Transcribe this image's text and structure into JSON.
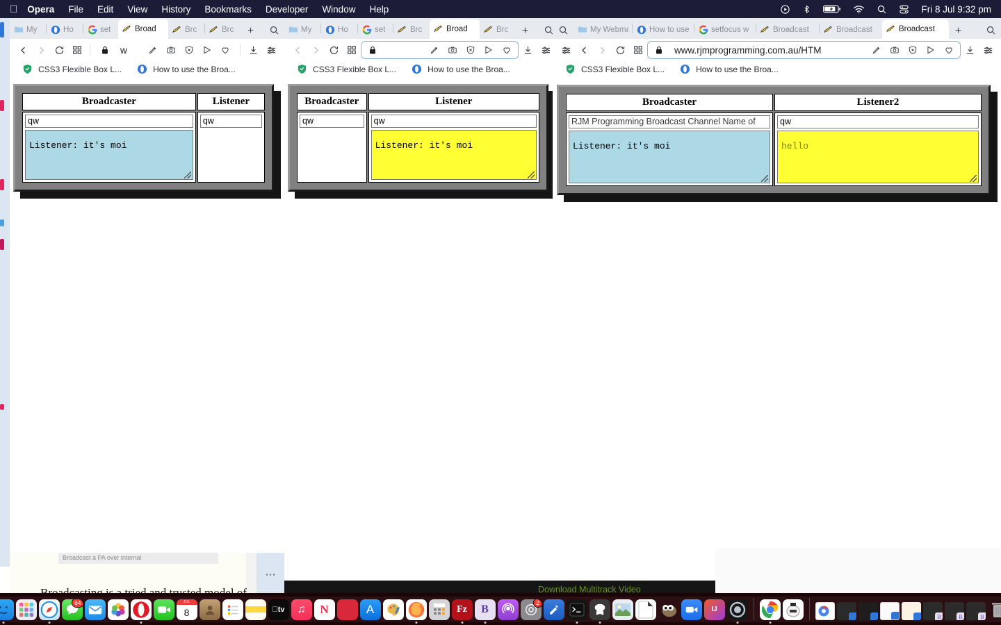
{
  "menubar": {
    "apple_icon": "apple-logo-icon",
    "items": [
      {
        "label": "Opera",
        "bold": true
      },
      {
        "label": "File",
        "bold": false
      },
      {
        "label": "Edit",
        "bold": false
      },
      {
        "label": "View",
        "bold": false
      },
      {
        "label": "History",
        "bold": false
      },
      {
        "label": "Bookmarks",
        "bold": false
      },
      {
        "label": "Developer",
        "bold": false
      },
      {
        "label": "Window",
        "bold": false
      },
      {
        "label": "Help",
        "bold": false
      }
    ],
    "status_icons": [
      "play-circle-icon",
      "bluetooth-icon",
      "battery-charging-icon",
      "wifi-icon",
      "search-icon",
      "control-center-icon"
    ],
    "clock": "Fri 8 Jul  9:32 pm"
  },
  "windows": [
    {
      "tabs": [
        {
          "label": "My",
          "favicon": "folder-icon",
          "active": false
        },
        {
          "label": "Ho",
          "favicon": "opera-blue-icon",
          "active": false
        },
        {
          "label": "set",
          "favicon": "google-icon",
          "active": false
        },
        {
          "label": "Broad",
          "favicon": "broadcast-icon",
          "active": true
        },
        {
          "label": "Brc",
          "favicon": "broadcast-icon",
          "active": false
        },
        {
          "label": "Brc",
          "favicon": "broadcast-icon",
          "active": false
        }
      ],
      "address": {
        "url": "w",
        "focused": false,
        "lock_icon": "padlock-icon"
      },
      "bookmarks": [
        {
          "label": "CSS3 Flexible Box L...",
          "favicon": "shield-green-icon"
        },
        {
          "label": "How to use the Broa...",
          "favicon": "opera-blue-icon"
        }
      ],
      "panel": {
        "columns": [
          "Broadcaster",
          "Listener"
        ],
        "broadcaster": {
          "input_value": "qw",
          "textarea_value": "Listener: it's moi",
          "textarea_color": "blue",
          "has_textarea": true
        },
        "listener": {
          "input_value": "qw",
          "textarea_value": "",
          "textarea_color": "none",
          "has_textarea": false
        }
      }
    },
    {
      "tabs": [
        {
          "label": "My",
          "favicon": "folder-icon",
          "active": false
        },
        {
          "label": "Ho",
          "favicon": "opera-blue-icon",
          "active": false
        },
        {
          "label": "set",
          "favicon": "google-icon",
          "active": false
        },
        {
          "label": "Brc",
          "favicon": "broadcast-icon",
          "active": false
        },
        {
          "label": "Broad",
          "favicon": "broadcast-icon",
          "active": true
        },
        {
          "label": "Brc",
          "favicon": "broadcast-icon",
          "active": false
        }
      ],
      "address": {
        "url": "",
        "focused": true,
        "lock_icon": "padlock-icon"
      },
      "bookmarks": [
        {
          "label": "CSS3 Flexible Box L...",
          "favicon": "shield-green-icon"
        },
        {
          "label": "How to use the Broa...",
          "favicon": "opera-blue-icon"
        }
      ],
      "panel": {
        "columns": [
          "Broadcaster",
          "Listener"
        ],
        "broadcaster": {
          "input_value": "qw",
          "textarea_value": "",
          "textarea_color": "none",
          "has_textarea": false
        },
        "listener": {
          "input_value": "qw",
          "textarea_value": "Listener: it's moi",
          "textarea_color": "yellow",
          "has_textarea": true
        }
      }
    },
    {
      "tabs": [
        {
          "label": "My Webma",
          "favicon": "folder-icon",
          "active": false
        },
        {
          "label": "How to use",
          "favicon": "opera-blue-icon",
          "active": false
        },
        {
          "label": "setfocus w",
          "favicon": "google-icon",
          "active": false
        },
        {
          "label": "Broadcast",
          "favicon": "broadcast-icon",
          "active": false
        },
        {
          "label": "Broadcast",
          "favicon": "broadcast-icon",
          "active": false
        },
        {
          "label": "Broadcast",
          "favicon": "broadcast-icon",
          "active": true
        }
      ],
      "address": {
        "url": "www.rjmprogramming.com.au/HTM",
        "focused": true,
        "lock_icon": "padlock-icon"
      },
      "bookmarks": [
        {
          "label": "CSS3 Flexible Box L...",
          "favicon": "shield-green-icon"
        },
        {
          "label": "How to use the Broa...",
          "favicon": "opera-blue-icon"
        }
      ],
      "panel": {
        "columns": [
          "Broadcaster",
          "Listener2"
        ],
        "broadcaster": {
          "input_value": "RJM Programming Broadcast Channel Name of",
          "input_is_placeholder": true,
          "textarea_value": "Listener: it's moi",
          "textarea_color": "blue",
          "has_textarea": true
        },
        "listener": {
          "input_value": "qw",
          "textarea_value": "hello",
          "textarea_is_placeholder": true,
          "textarea_color": "yellow",
          "has_textarea": true
        }
      }
    }
  ],
  "toolbar_icons": {
    "back": "chevron-left-icon",
    "forward": "chevron-right-icon",
    "reload": "reload-icon",
    "tiles": "grid-tiles-icon",
    "download": "download-icon",
    "settings": "sliders-icon",
    "pin": "pin-edit-icon",
    "snapshot": "camera-icon",
    "adblock": "shield-x-icon",
    "share": "send-triangle-icon",
    "favorite": "heart-icon",
    "search": "search-icon",
    "plus": "plus-icon"
  },
  "background_windows": {
    "left_text": "Broadcasting is a tried and trusted model of",
    "left_caption": "Broadcast a PA over internal",
    "more_icon": "ellipsis-icon",
    "right_text": "Download Multitrack Video",
    "right_text_color": "#6a8f2a"
  },
  "dock": {
    "items": [
      {
        "name": "finder",
        "glyph": "",
        "bg": "linear-gradient(180deg,#2ba8f5,#1c7fe0)",
        "running": true
      },
      {
        "name": "launchpad",
        "glyph": "",
        "bg": "#e9e9ee",
        "running": false
      },
      {
        "name": "safari",
        "glyph": "",
        "bg": "linear-gradient(180deg,#f2f7fb,#cfe3f3)",
        "running": true
      },
      {
        "name": "messages",
        "glyph": "",
        "bg": "linear-gradient(180deg,#6ee86c,#23c11f)",
        "badge": "64",
        "running": false
      },
      {
        "name": "mail",
        "glyph": "",
        "bg": "linear-gradient(180deg,#4ab8f7,#1d8ce8)",
        "running": false
      },
      {
        "name": "photos",
        "glyph": "",
        "bg": "#ffffff",
        "running": false
      },
      {
        "name": "opera",
        "glyph": "",
        "bg": "#ffffff",
        "running": true
      },
      {
        "name": "facetime",
        "glyph": "",
        "bg": "linear-gradient(180deg,#5ce45a,#22c21f)",
        "running": false
      },
      {
        "name": "calendar",
        "glyph": "8",
        "bg": "#ffffff",
        "running": false
      },
      {
        "name": "contacts",
        "glyph": "",
        "bg": "linear-gradient(180deg,#c09a6b,#8a6b44)",
        "running": false
      },
      {
        "name": "reminders",
        "glyph": "",
        "bg": "#ffffff",
        "running": false
      },
      {
        "name": "notes",
        "glyph": "",
        "bg": "linear-gradient(180deg,#ffd83d,#fff8e0)",
        "running": false
      },
      {
        "name": "apple-tv",
        "glyph": "tv",
        "bg": "#0b0b0b",
        "running": false
      },
      {
        "name": "music",
        "glyph": "",
        "bg": "linear-gradient(180deg,#fb4c6a,#f5305a)",
        "running": false
      },
      {
        "name": "news",
        "glyph": "N",
        "bg": "#ffffff",
        "running": false
      },
      {
        "name": "keynote-red",
        "glyph": "",
        "bg": "#d8283a",
        "running": false
      },
      {
        "name": "app-store",
        "glyph": "A",
        "bg": "linear-gradient(180deg,#2c9df7,#0b6fdc)",
        "running": false
      },
      {
        "name": "paint-palette",
        "glyph": "",
        "bg": "#ffffff",
        "running": false
      },
      {
        "name": "firefox",
        "glyph": "",
        "bg": "#ffffff",
        "running": true
      },
      {
        "name": "calculator",
        "glyph": "",
        "bg": "#d5d5d8",
        "running": false
      },
      {
        "name": "filezilla",
        "glyph": "Fz",
        "bg": "#b4121b",
        "running": true
      },
      {
        "name": "bootstrap",
        "glyph": "B",
        "bg": "#e6e0f2",
        "running": true
      },
      {
        "name": "podcasts",
        "glyph": "",
        "bg": "linear-gradient(180deg,#bf5af2,#8e3fd4)",
        "running": false
      },
      {
        "name": "system-settings",
        "glyph": "",
        "bg": "#8a8a8f",
        "badge": "2",
        "running": false
      },
      {
        "name": "xcode",
        "glyph": "",
        "bg": "linear-gradient(180deg,#3a7ddd,#1b5bbf)",
        "running": false
      },
      {
        "name": "terminal",
        "glyph": "",
        "bg": "#1a1a1a",
        "running": true
      },
      {
        "name": "mamp",
        "glyph": "",
        "bg": "#3a3a3a",
        "running": true
      },
      {
        "name": "preview",
        "glyph": "",
        "bg": "#e8eef4",
        "running": false
      },
      {
        "name": "textedit",
        "glyph": "",
        "bg": "#ffffff",
        "running": false
      },
      {
        "name": "gimp",
        "glyph": "",
        "bg": "transparent",
        "running": false
      },
      {
        "name": "zoom",
        "glyph": "",
        "bg": "linear-gradient(180deg,#3d8bfd,#1a6fe8)",
        "running": false
      },
      {
        "name": "intellij",
        "glyph": "IJ",
        "bg": "linear-gradient(135deg,#f05a28,#9b3bd9)",
        "running": false
      },
      {
        "name": "quicktime",
        "glyph": "",
        "bg": "#1a1a1a",
        "running": false
      }
    ],
    "items2": [
      {
        "name": "chrome",
        "glyph": "",
        "bg": "#ffffff",
        "running": true
      },
      {
        "name": "postman",
        "glyph": "",
        "bg": "#ffffff",
        "running": false
      }
    ],
    "minimized": [
      {
        "name": "chrome-document-window"
      },
      {
        "name": "dark-browser-window"
      },
      {
        "name": "dark-page-window"
      },
      {
        "name": "editor-window"
      },
      {
        "name": "white-window"
      },
      {
        "name": "orange-window"
      },
      {
        "name": "bootstrap-window-1"
      },
      {
        "name": "bootstrap-window-2"
      },
      {
        "name": "bootstrap-window-3"
      }
    ],
    "trash": {
      "name": "trash-icon"
    }
  }
}
